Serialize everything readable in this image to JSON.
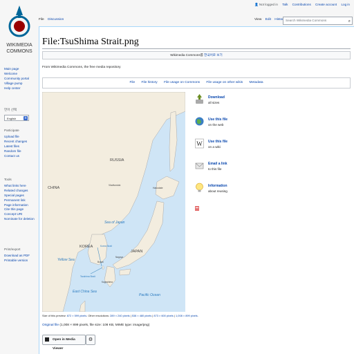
{
  "logo": {
    "line1": "WIKIMEDIA",
    "line2": "COMMONS"
  },
  "personal": {
    "not_logged_in": "Not logged in",
    "talk": "Talk",
    "contributions": "Contributions",
    "create_account": "Create account",
    "log_in": "Log in"
  },
  "tabs_left": [
    "File",
    "Discussion"
  ],
  "tabs_right": [
    "View",
    "Edit",
    "History"
  ],
  "search": {
    "placeholder": "Search Wikimedia Commons"
  },
  "sidebar": {
    "nav": [
      "Main page",
      "Welcome",
      "Community portal",
      "Village pump",
      "Help center"
    ],
    "lang_heading": "언어 선택",
    "lang_value": "English",
    "participate_heading": "Participate",
    "participate": [
      "Upload file",
      "Recent changes",
      "Latest files",
      "Random file",
      "Contact us"
    ],
    "tools_heading": "Tools",
    "tools": [
      "What links here",
      "Related changes",
      "Special pages",
      "Permanent link",
      "Page information",
      "Cite this page",
      "Concept URI",
      "Nominate for deletion"
    ],
    "print_heading": "Print/export",
    "print": [
      "Download as PDF",
      "Printable version"
    ]
  },
  "page": {
    "title": "File:TsuShima Strait.png",
    "banner_prefix": "Wikimedia Commons를",
    "banner_link": "한국어로 보기",
    "from": "From Wikimedia Commons, the free media repository",
    "file_tabs": [
      "File",
      "File history",
      "File usage on Commons",
      "File usage on other wikis",
      "Metadata"
    ]
  },
  "map_labels": {
    "russia": "RUSSIA",
    "china": "CHINA",
    "vladivostok": "Vladivostok",
    "hakodate": "Hakodate",
    "sea_of_japan": "Sea of Japan",
    "korea": "KOREA",
    "japan": "JAPAN",
    "yellow_sea": "Yellow Sea",
    "east_china_sea": "East China Sea",
    "pacific_ocean": "Pacific Ocean",
    "busan": "Busan",
    "nagoya": "Nagoya",
    "kagoshima": "Kagoshima",
    "korea_strait": "Korea Strait",
    "tsushima_strait": "Tsushima Strait"
  },
  "actions": [
    {
      "icon": "download-icon",
      "title": "Download",
      "sub": "all sizes"
    },
    {
      "icon": "globe-icon",
      "title": "Use this file",
      "sub": "on the web"
    },
    {
      "icon": "wikipedia-icon",
      "title": "Use this file",
      "sub": "on a wiki"
    },
    {
      "icon": "email-icon",
      "title": "Email a link",
      "sub": "to this file"
    },
    {
      "icon": "info-bulb-icon",
      "title": "Information",
      "sub": "about reusing"
    }
  ],
  "caption": {
    "prefix": "Size of this preview:",
    "preview": "872 × 599 pixels",
    "other": ". Other resolutions:",
    "res": [
      "289 × 240 pixels",
      "538 × 480 pixels",
      "873 × 600 pixels",
      "1,008 × 899 pixels"
    ]
  },
  "original": {
    "link": "Original file",
    "meta": "(1,008 × 899 pixels, file size: 108 KB, MIME type: image/png)"
  },
  "media_viewer": {
    "label": "Open in Media Viewer"
  },
  "colors": {
    "link": "#0645ad",
    "sea": "#cfe5f6",
    "land": "#f3eddf"
  }
}
